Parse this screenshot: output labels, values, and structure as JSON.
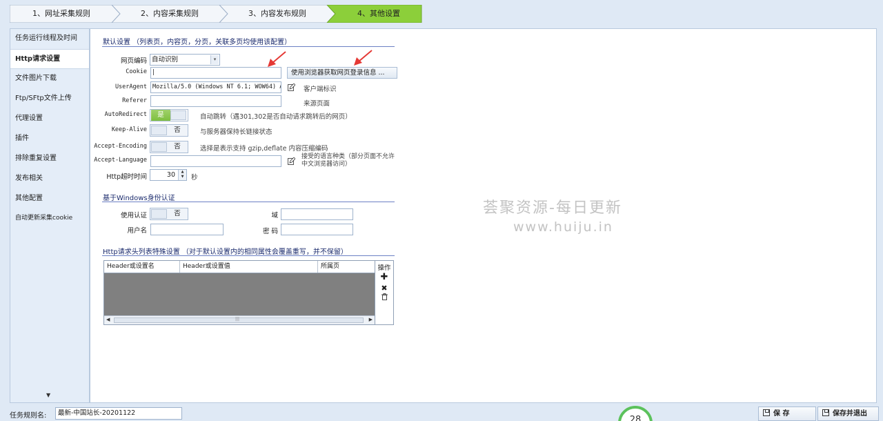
{
  "steps": [
    "1、网址采集规则",
    "2、内容采集规则",
    "3、内容发布规则",
    "4、其他设置"
  ],
  "sidebar": {
    "items": [
      "任务运行线程及时间",
      "Http请求设置",
      "文件图片下载",
      "Ftp/SFtp文件上传",
      "代理设置",
      "插件",
      "排除重复设置",
      "发布相关",
      "其他配置",
      "自动更新采集cookie"
    ],
    "scroll_icon": "chevron-down-icon"
  },
  "default_section": {
    "title": "默认设置 （列表页，内容页，分页，关联多页均使用该配置）",
    "encoding_label": "网页编码",
    "encoding_value": "自动识别",
    "cookie_label": "Cookie",
    "cookie_value": "|",
    "browser_button": "使用浏览器获取网页登录信息 ...",
    "useragent_label": "UserAgent",
    "useragent_value": "Mozilla/5.0 (Windows NT 6.1; WOW64) A",
    "useragent_hint": "客户端标识",
    "referer_label": "Referer",
    "referer_value": "",
    "referer_hint": "来源页面",
    "autoredirect_label": "AutoRedirect",
    "autoredirect_value": "是",
    "autoredirect_hint": "自动跳转（遇301,302是否自动请求跳转后的网页）",
    "keepalive_label": "Keep-Alive",
    "keepalive_value": "否",
    "keepalive_hint": "与服务器保持长链接状态",
    "encoding2_label": "Accept-Encoding",
    "encoding2_value": "否",
    "encoding2_hint": "选择是表示支持 gzip,deflate 内容压缩编码",
    "language_label": "Accept-Language",
    "language_value": "",
    "language_hint": "接受的语言种类（部分页面不允许中文浏览器访问）",
    "timeout_label": "Http超时时间",
    "timeout_value": "30",
    "timeout_unit": "秒"
  },
  "windows_section": {
    "title": "基于Windows身份认证",
    "use_auth_label": "使用认证",
    "use_auth_value": "否",
    "domain_label": "域",
    "domain_value": "",
    "username_label": "用户名",
    "username_value": "",
    "password_label": "密  码",
    "password_value": ""
  },
  "header_section": {
    "title": "Http请求头列表特殊设置 （对于默认设置内的相同属性会覆盖重写，并不保留）",
    "columns": [
      "Header或设置名",
      "Header或设置值",
      "所属页"
    ],
    "ops_label": "操作",
    "scroll_mark": "|||"
  },
  "watermark": {
    "line1": "荟聚资源-每日更新",
    "line2": "www.huiju.in"
  },
  "bottom": {
    "task_name_label": "任务规则名:",
    "task_name_value": "最新-中国站长-20201122",
    "gauge_value": "28",
    "save_label": "保 存",
    "save_exit_label": "保存并退出"
  },
  "colors": {
    "active_step": "#8ccf3a",
    "toggle_on": "#7ebf3f",
    "section_line": "#6b7fc4",
    "arrow": "#e53935"
  }
}
